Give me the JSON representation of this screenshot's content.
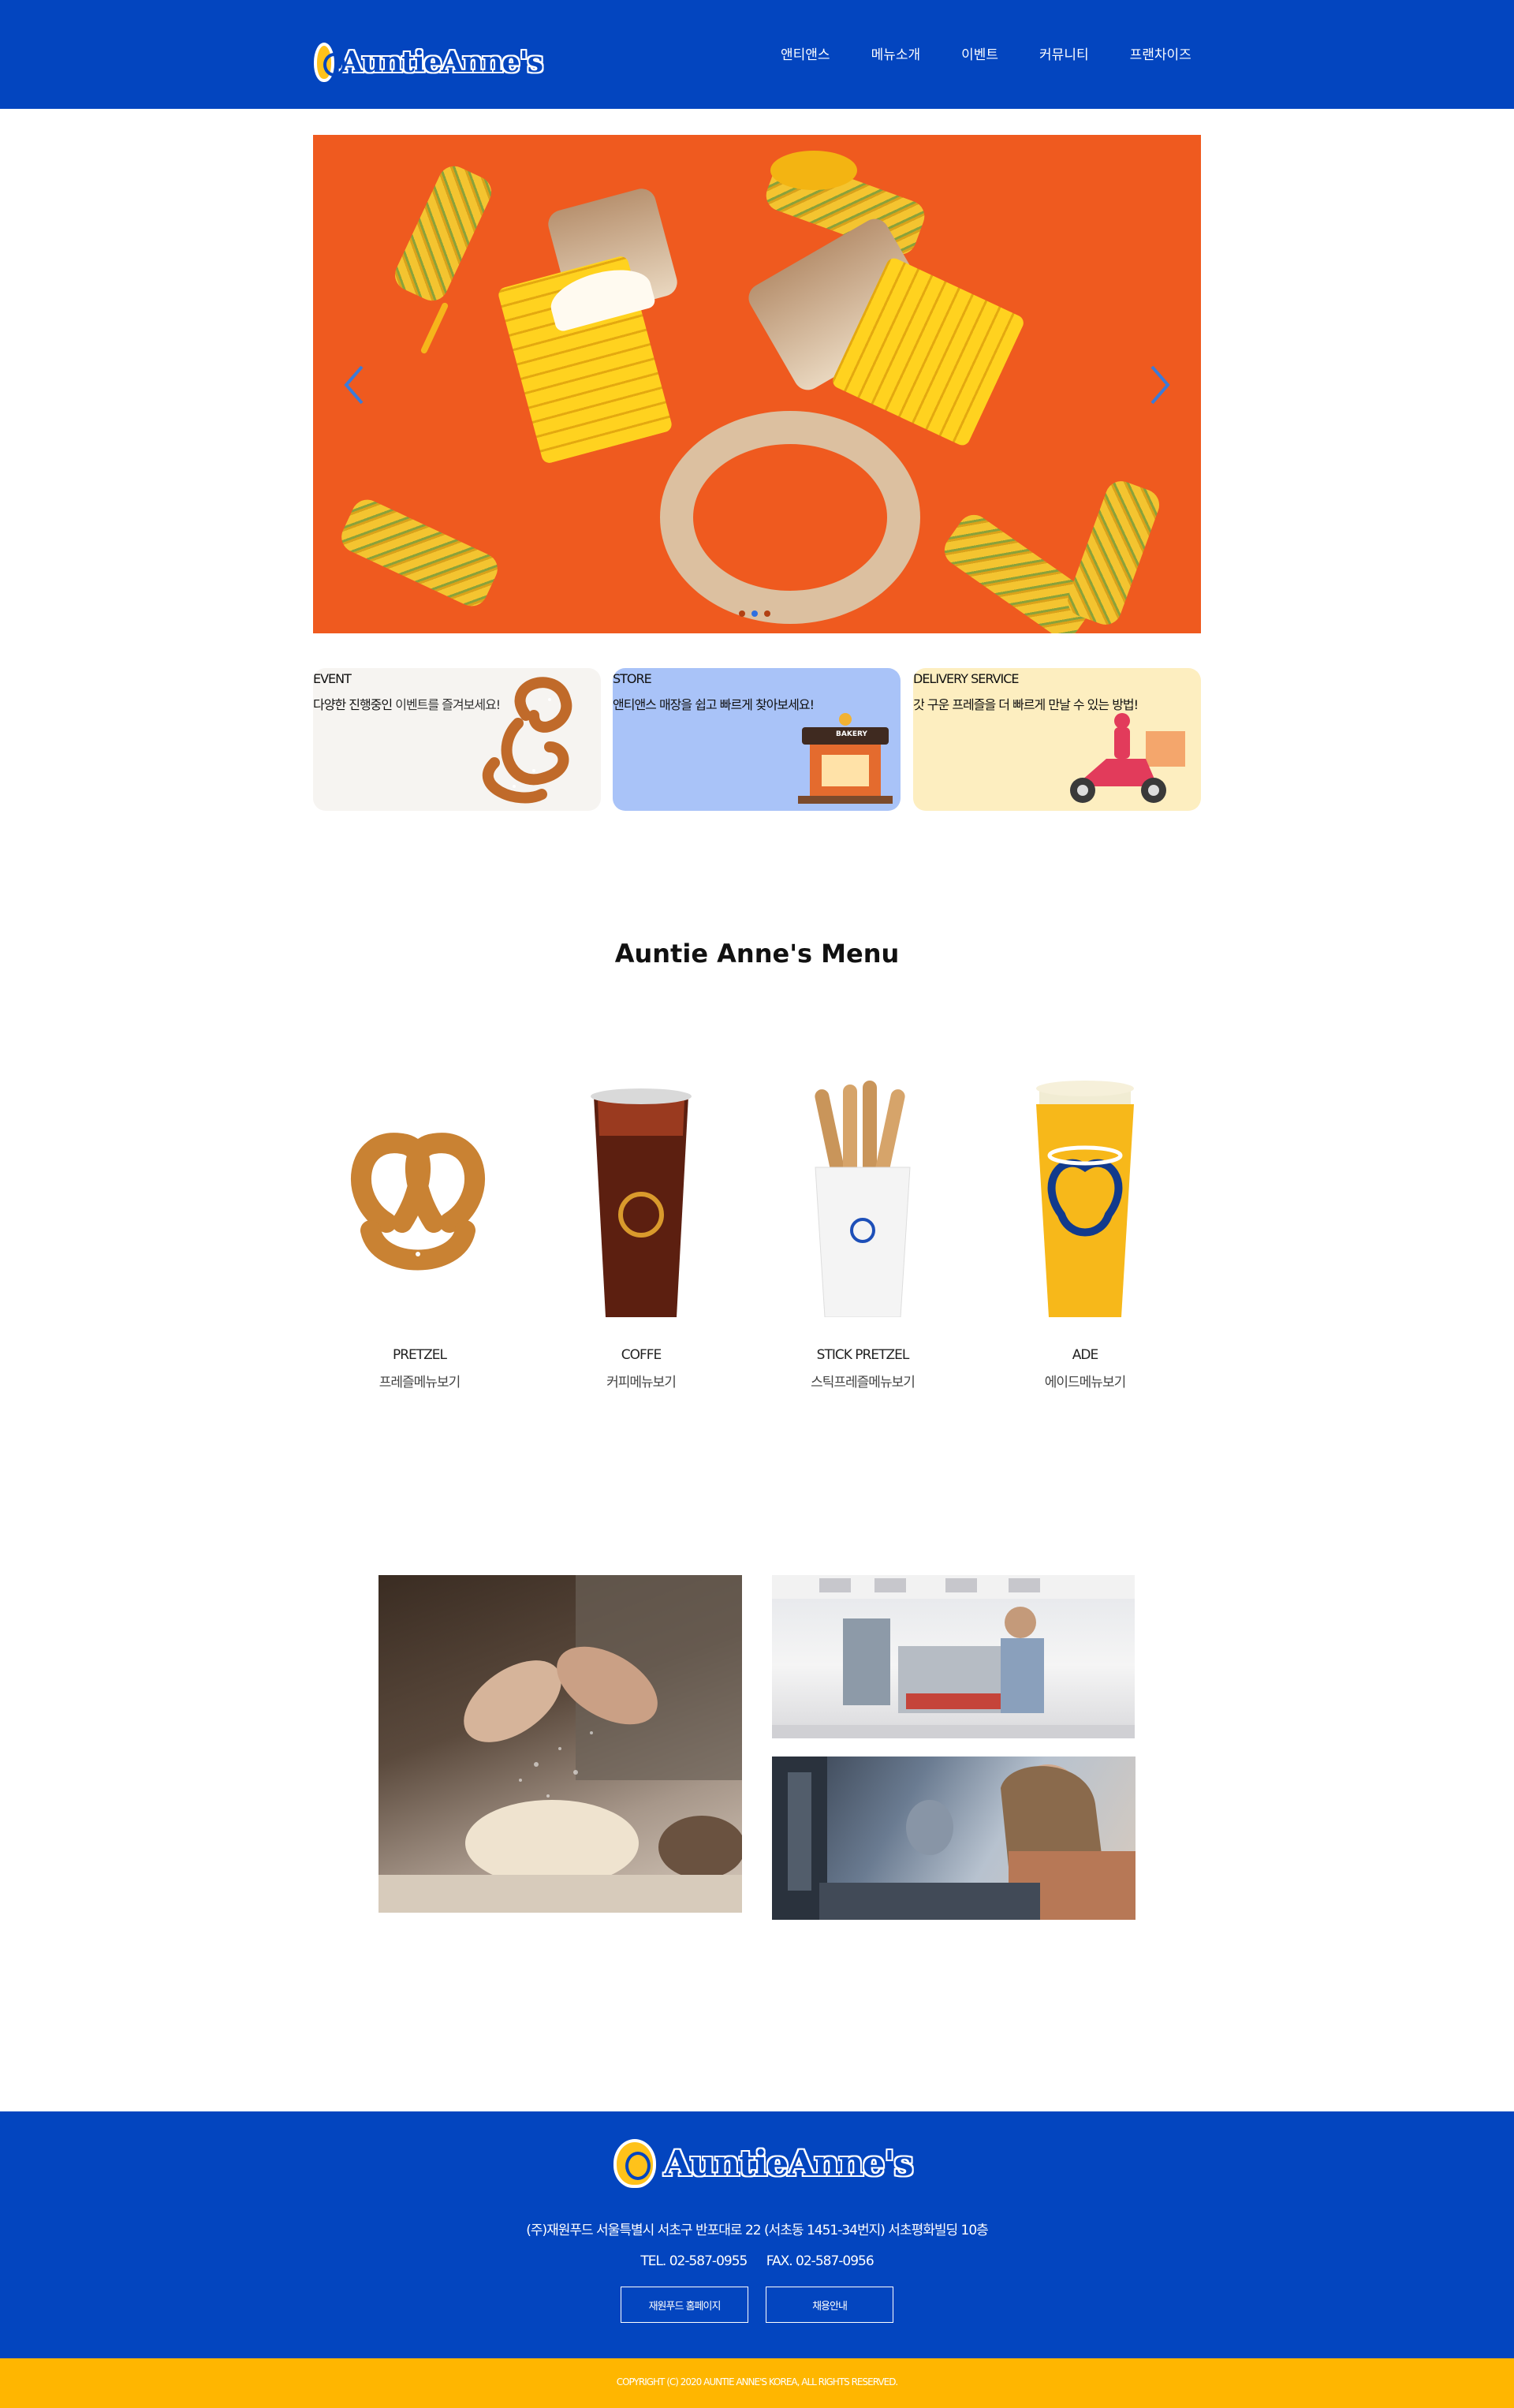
{
  "brand": {
    "logo_main": "AuntieAnne",
    "logo_suffix": "'s"
  },
  "nav": {
    "items": [
      "앤티앤스",
      "메뉴소개",
      "이벤트",
      "커뮤니티",
      "프랜차이즈"
    ]
  },
  "hero": {
    "slide_count": 3,
    "active_slide": 2
  },
  "cards": {
    "event": {
      "title": "EVENT",
      "desc_a": "다양한 진행중인 ",
      "desc_b": "이벤트를 즐겨보세요!"
    },
    "store": {
      "title": "STORE",
      "desc": "앤티앤스 매장을 쉽고 빠르게 찾아보세요!",
      "sign": "BAKERY"
    },
    "delivery": {
      "title": "DELIVERY SERVICE",
      "desc": "갓 구운 프레즐을 더 빠르게 만날 수 있는 방법!"
    }
  },
  "menu": {
    "title": "Auntie Anne's Menu",
    "items": [
      {
        "name": "PRETZEL",
        "link": "프레즐메뉴보기"
      },
      {
        "name": "COFFE",
        "link": "커피메뉴보기"
      },
      {
        "name": "STICK PRETZEL",
        "link": "스틱프레즐메뉴보기"
      },
      {
        "name": "ADE",
        "link": "에이드메뉴보기"
      }
    ]
  },
  "footer": {
    "address": "(주)재원푸드 서울특별시 서초구 반포대로 22 (서초동 1451-34번지) 서초평화빌딩 10층",
    "tel": "TEL. 02-587-0955",
    "fax": "FAX. 02-587-0956",
    "btn_home": "재원푸드 홈페이지",
    "btn_recruit": "채용안내",
    "copyright": "COPYRIGHT (C) 2020 AUNTIE ANNE'S KOREA, ALL RIGHTS RESERVED."
  },
  "colors": {
    "header_blue": "#0345bf",
    "brand_yellow": "#ffc21a",
    "copyright_bar": "#ffb600",
    "hero_orange": "#ef5a1f"
  }
}
